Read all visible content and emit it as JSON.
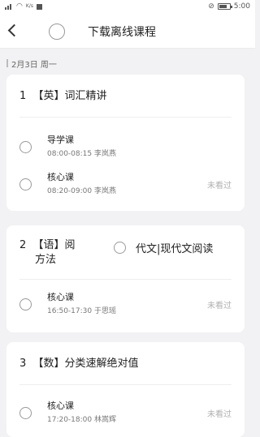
{
  "status_bar": {
    "time": "5:00",
    "network": "K/s"
  },
  "header": {
    "title": "下载离线课程"
  },
  "date": "2月3日 周一",
  "courses": [
    {
      "number": "1",
      "title": "【英】词汇精讲",
      "lessons": [
        {
          "name": "导学课",
          "meta": "08:00-08:15 李岚燕",
          "status": ""
        },
        {
          "name": "核心课",
          "meta": "08:20-09:00 李岚燕",
          "status": "未看过"
        }
      ]
    },
    {
      "number": "2",
      "title_line1": "【语】阅",
      "title_line2": "方法",
      "option": "代文|现代文阅读",
      "lessons": [
        {
          "name": "核心课",
          "meta": "16:50-17:30 于思瑶",
          "status": "未看过"
        }
      ]
    },
    {
      "number": "3",
      "title": "【数】分类速解绝对值",
      "lessons": [
        {
          "name": "核心课",
          "meta": "17:20-18:00 林嵩辉",
          "status": "未看过"
        }
      ]
    }
  ]
}
